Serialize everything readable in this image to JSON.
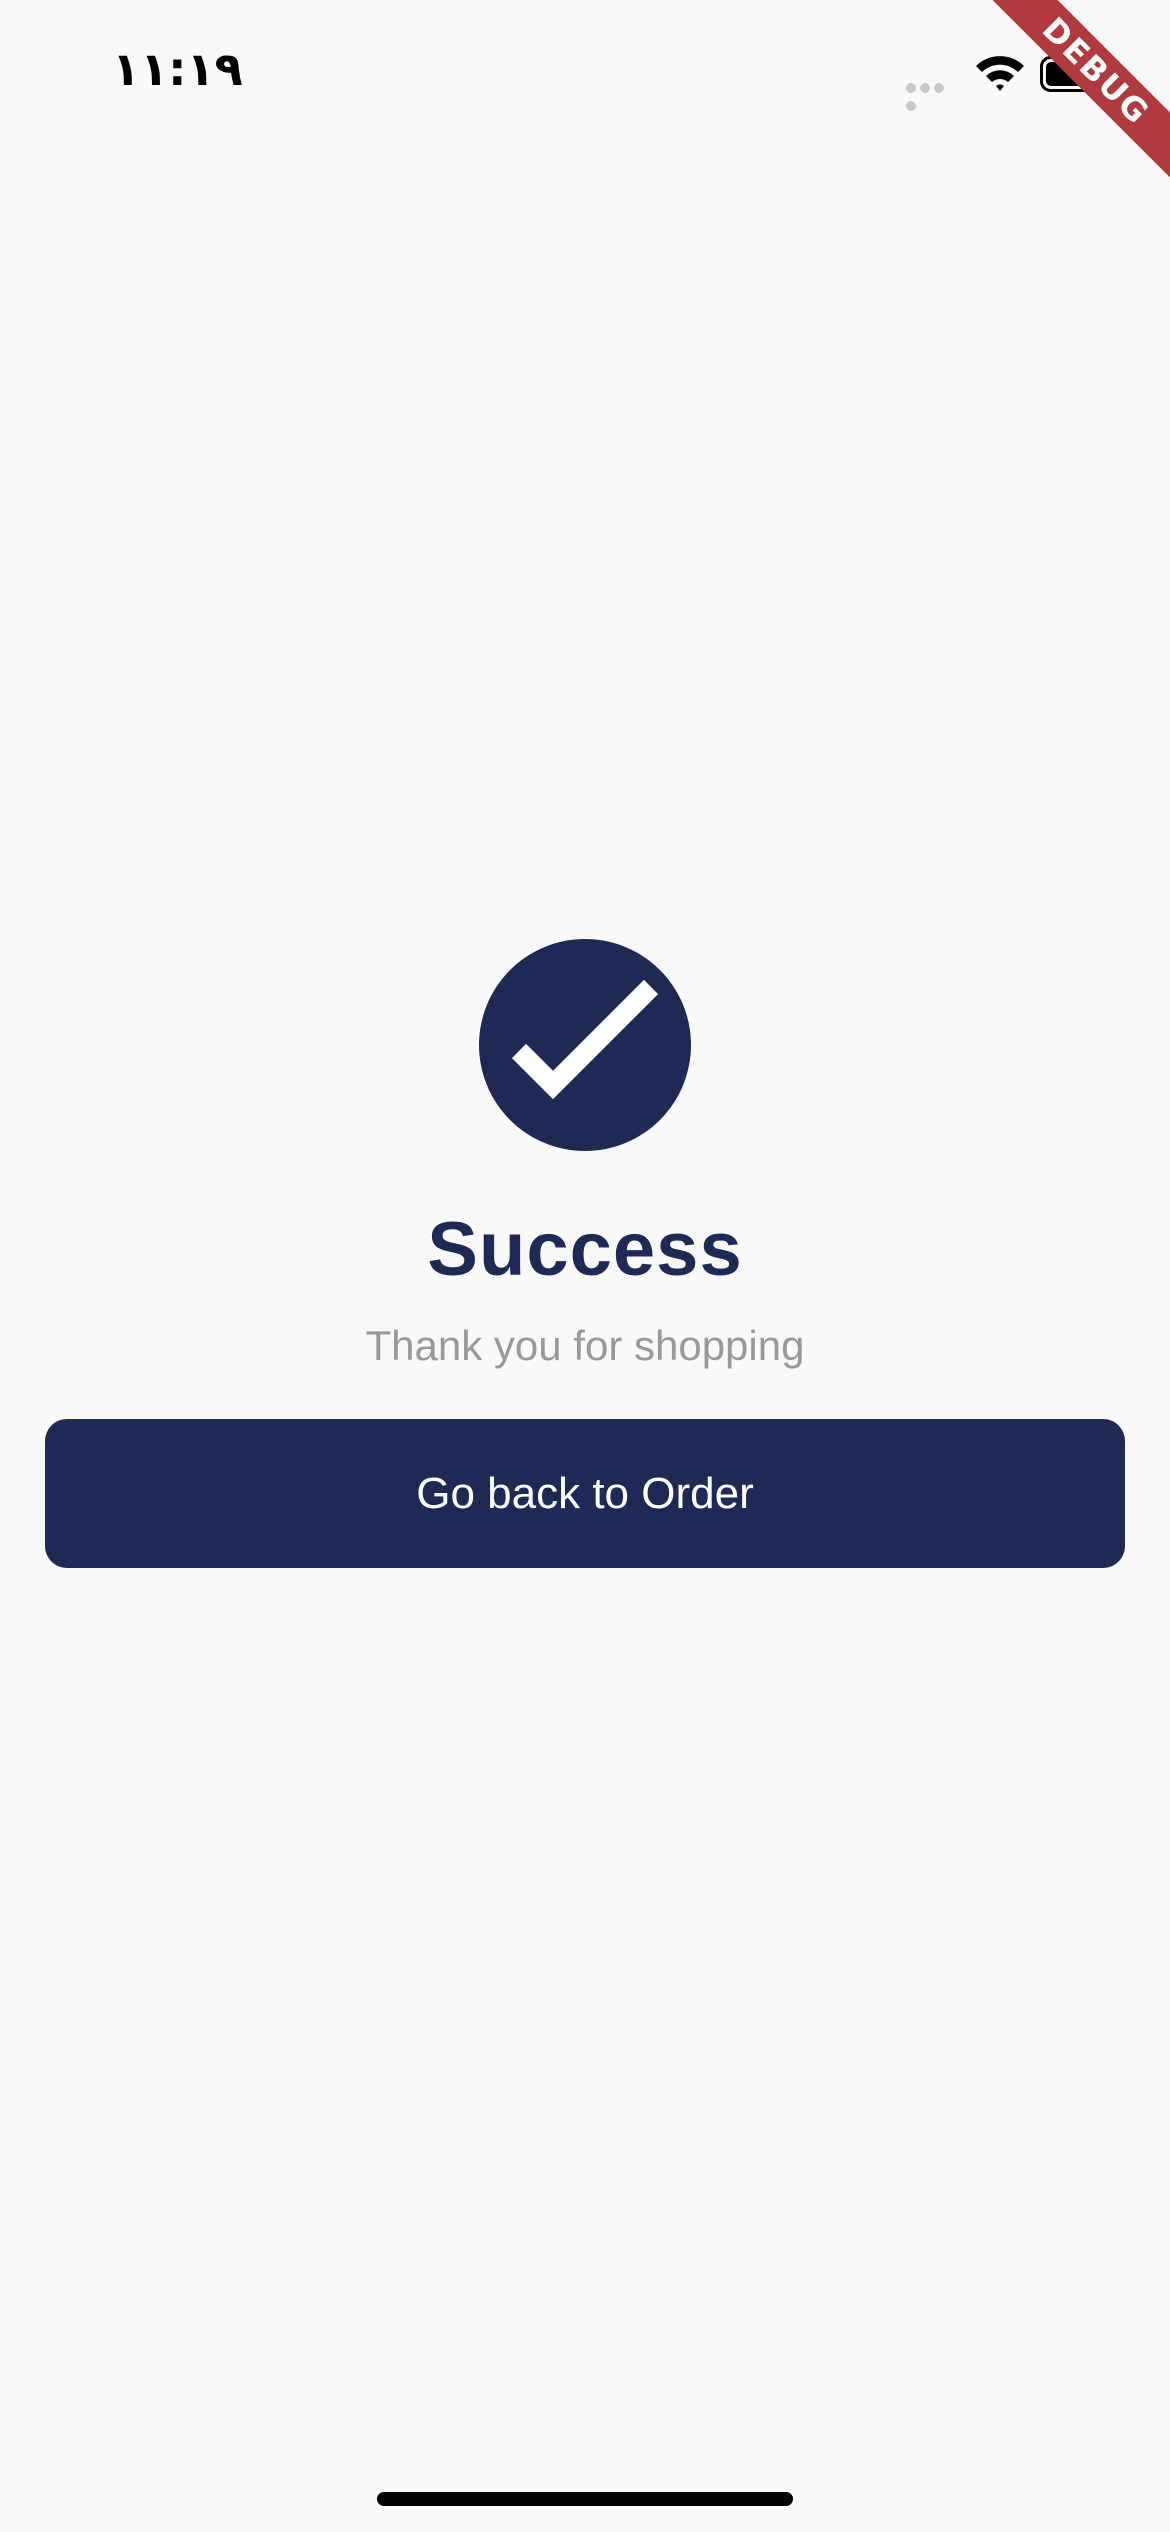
{
  "status_bar": {
    "time": "١١:١٩",
    "wifi_icon": "wifi-icon",
    "battery_icon": "battery-icon"
  },
  "debug_banner": {
    "label": "DEBUG",
    "color": "#b13a3f"
  },
  "success": {
    "icon": "check-icon",
    "title": "Success",
    "subtitle": "Thank you for shopping"
  },
  "actions": {
    "go_back_label": "Go back to Order"
  },
  "colors": {
    "background": "#f9f9fa",
    "primary": "#1f2955",
    "muted_text": "#999999"
  }
}
